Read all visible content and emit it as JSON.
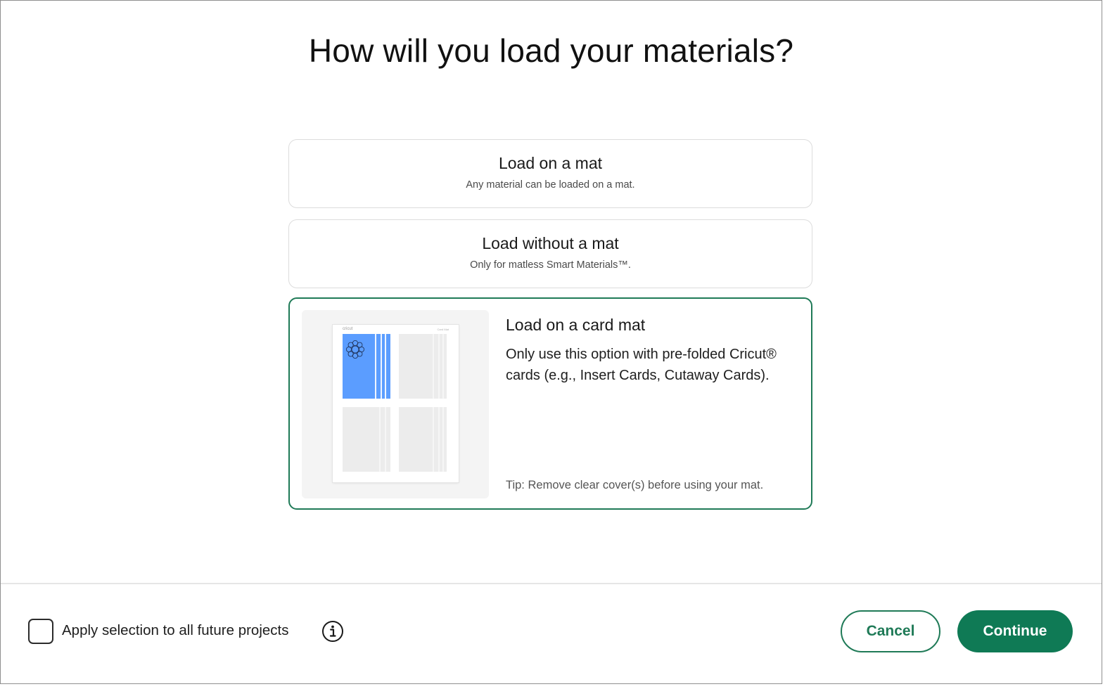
{
  "dialog": {
    "title": "How will you load your materials?"
  },
  "options": [
    {
      "title": "Load on a mat",
      "subtitle": "Any material can be loaded on a mat.",
      "selected": false
    },
    {
      "title": "Load without a mat",
      "subtitle": "Only for matless Smart Materials™.",
      "selected": false
    },
    {
      "title": "Load on a card mat",
      "description": "Only use this option with pre-folded Cricut® cards (e.g., Insert Cards, Cutaway Cards).",
      "tip": "Tip: Remove clear cover(s) before using your mat.",
      "selected": true,
      "preview": {
        "brand": "cricut",
        "size": "Card Mat"
      }
    }
  ],
  "footer": {
    "apply_label": "Apply selection to all future projects",
    "apply_checked": false,
    "cancel_label": "Cancel",
    "continue_label": "Continue"
  },
  "colors": {
    "accent": "#0f7a55",
    "accent_border": "#1f7a57",
    "preview_blue": "#5b9dff"
  },
  "icons": {
    "info": "info-circle-icon",
    "preview_motif": "flower-icon"
  }
}
